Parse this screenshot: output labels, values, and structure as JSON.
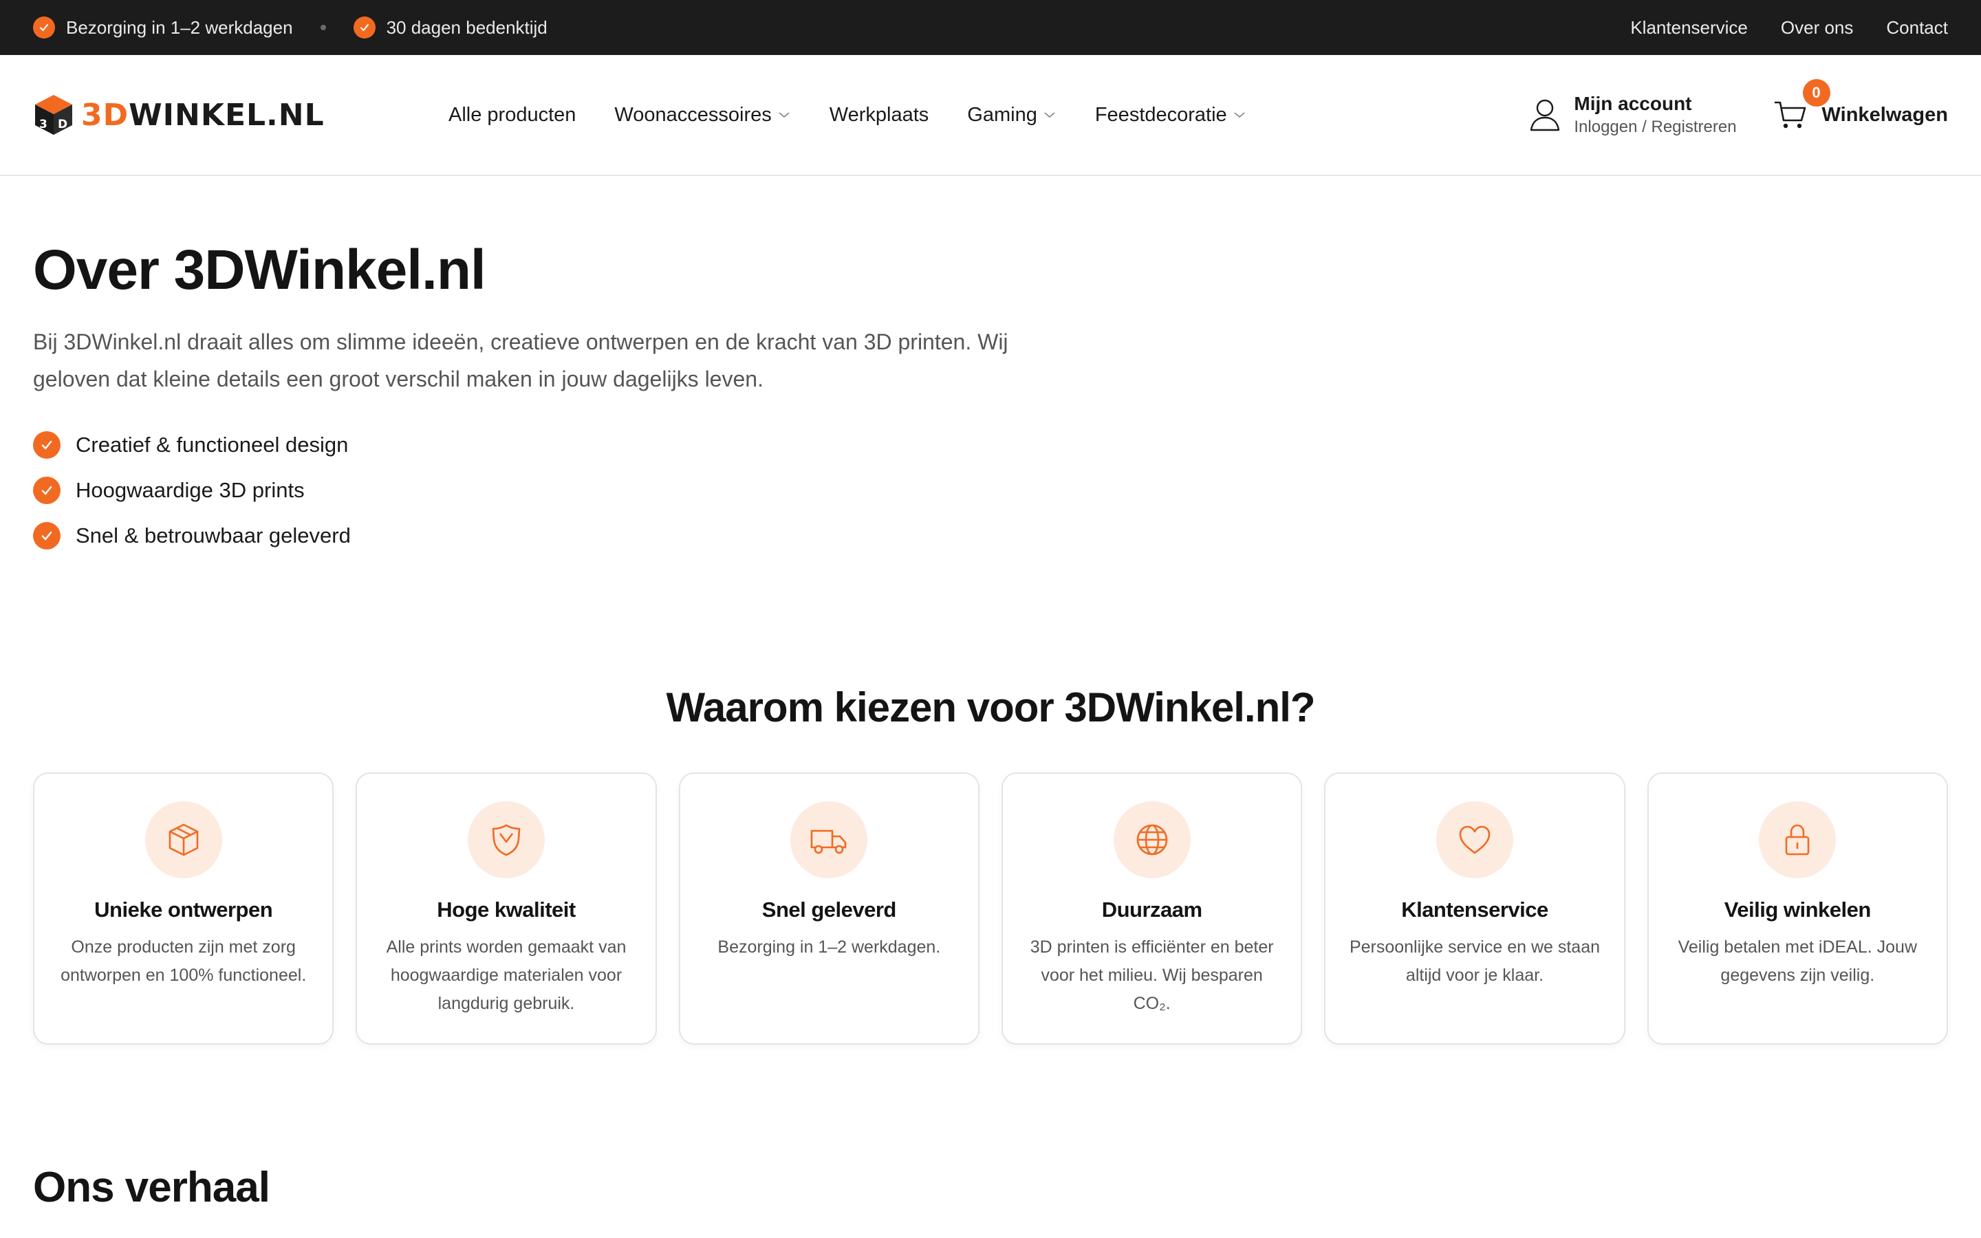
{
  "topbar": {
    "usps": [
      "Bezorging in 1–2 werkdagen",
      "30 dagen bedenktijd"
    ],
    "links": [
      "Klantenservice",
      "Over ons",
      "Contact"
    ]
  },
  "header": {
    "logo": {
      "part1": "3D",
      "part2": "WINKEL.NL"
    },
    "nav": [
      {
        "label": "Alle producten",
        "dropdown": false
      },
      {
        "label": "Woonaccessoires",
        "dropdown": true
      },
      {
        "label": "Werkplaats",
        "dropdown": false
      },
      {
        "label": "Gaming",
        "dropdown": true
      },
      {
        "label": "Feestdecoratie",
        "dropdown": true
      }
    ],
    "account": {
      "title": "Mijn account",
      "subtitle": "Inloggen / Registreren"
    },
    "cart": {
      "count": "0",
      "label": "Winkelwagen"
    }
  },
  "hero": {
    "title": "Over 3DWinkel.nl",
    "intro": "Bij 3DWinkel.nl draait alles om slimme ideeën, creatieve ontwerpen en de kracht van 3D printen. Wij geloven dat kleine details een groot verschil maken in jouw dagelijks leven.",
    "bullets": [
      "Creatief & functioneel design",
      "Hoogwaardige 3D prints",
      "Snel & betrouwbaar geleverd"
    ]
  },
  "why": {
    "title": "Waarom kiezen voor 3DWinkel.nl?",
    "cards": [
      {
        "icon": "box-icon",
        "title": "Unieke ontwerpen",
        "text": "Onze producten zijn met zorg ontworpen en 100% functioneel."
      },
      {
        "icon": "shield-icon",
        "title": "Hoge kwaliteit",
        "text": "Alle prints worden gemaakt van hoogwaardige materialen voor langdurig gebruik."
      },
      {
        "icon": "truck-icon",
        "title": "Snel geleverd",
        "text": "Bezorging in 1–2 werkdagen."
      },
      {
        "icon": "globe-icon",
        "title": "Duurzaam",
        "text": "3D printen is efficiënter en beter voor het milieu. Wij besparen CO₂."
      },
      {
        "icon": "heart-icon",
        "title": "Klantenservice",
        "text": "Persoonlijke service en we staan altijd voor je klaar."
      },
      {
        "icon": "lock-icon",
        "title": "Veilig winkelen",
        "text": "Veilig betalen met iDEAL. Jouw gegevens zijn veilig."
      }
    ]
  },
  "story": {
    "title": "Ons verhaal"
  },
  "colors": {
    "accent": "#f26a22",
    "topbar": "#1c1c1c",
    "icon_bg": "#fdebdf"
  }
}
